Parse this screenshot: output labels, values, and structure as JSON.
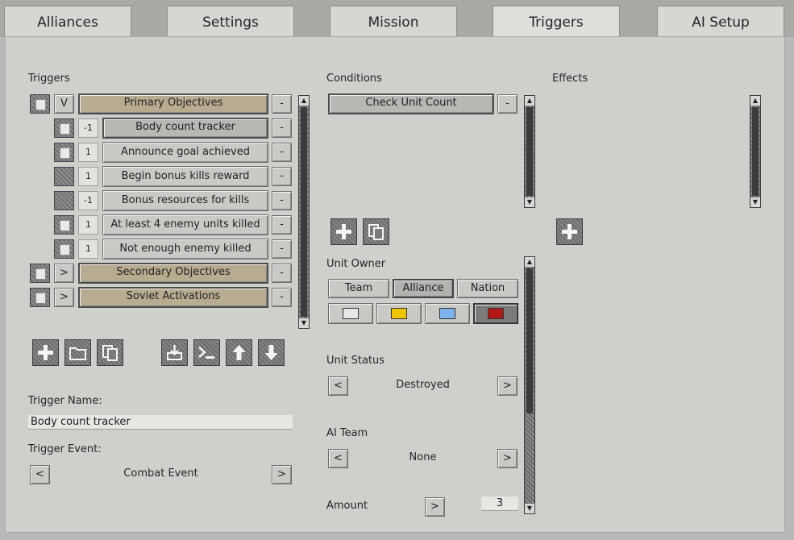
{
  "tabs": [
    "Alliances",
    "Settings",
    "Mission",
    "Triggers",
    "AI Setup"
  ],
  "triggers": {
    "label": "Triggers",
    "group_primary": {
      "toggle": "V",
      "name": "Primary Objectives",
      "remove": "-"
    },
    "items": [
      {
        "num": "-1",
        "name": "Body count tracker",
        "remove": "-"
      },
      {
        "num": "1",
        "name": "Announce goal achieved",
        "remove": "-"
      },
      {
        "num": "1",
        "name": "Begin bonus kills reward",
        "remove": "-"
      },
      {
        "num": "-1",
        "name": "Bonus resources for kills",
        "remove": "-"
      },
      {
        "num": "1",
        "name": "At least 4 enemy units killed",
        "remove": "-"
      },
      {
        "num": "1",
        "name": "Not enough enemy killed",
        "remove": "-"
      }
    ],
    "groups": [
      {
        "toggle": ">",
        "name": "Secondary Objectives",
        "remove": "-"
      },
      {
        "toggle": ">",
        "name": "Soviet Activations",
        "remove": "-"
      }
    ]
  },
  "trigger_name": {
    "label": "Trigger Name:",
    "value": "Body count tracker"
  },
  "trigger_event": {
    "label": "Trigger Event:",
    "prev": "<",
    "value": "Combat Event",
    "next": ">"
  },
  "conditions": {
    "label": "Conditions",
    "item": "Check Unit Count",
    "remove": "-"
  },
  "unit_owner": {
    "label": "Unit Owner",
    "options": [
      "Team",
      "Alliance",
      "Nation"
    ],
    "selected": "Alliance",
    "colors": [
      "#e6e6e6",
      "#f0c400",
      "#7fb3ef",
      "#b01b18"
    ],
    "selected_color": "#b01b18"
  },
  "unit_status": {
    "label": "Unit Status",
    "prev": "<",
    "value": "Destroyed",
    "next": ">"
  },
  "ai_team": {
    "label": "AI Team",
    "prev": "<",
    "value": "None",
    "next": ">"
  },
  "amount": {
    "label": "Amount",
    "next": ">",
    "value": "3"
  },
  "effects": {
    "label": "Effects"
  },
  "icons": {
    "add": "plus-icon",
    "folder": "folder-icon",
    "copy": "copy-icon",
    "import": "import-icon",
    "console": "console-icon",
    "up": "arrow-up-icon",
    "down": "arrow-down-icon"
  }
}
